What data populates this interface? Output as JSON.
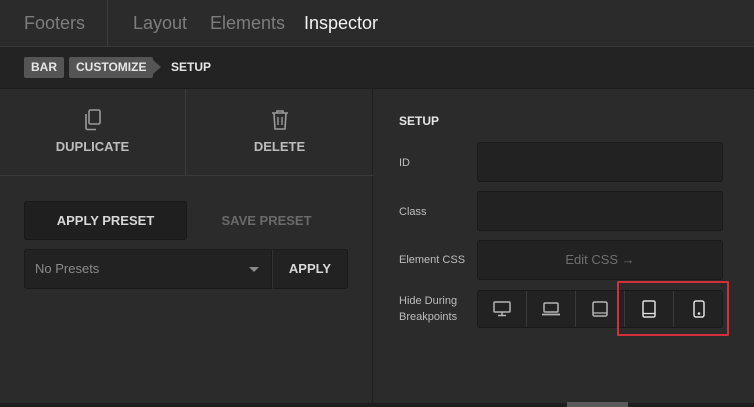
{
  "tabs": [
    {
      "label": "Footers"
    },
    {
      "label": "Layout"
    },
    {
      "label": "Elements"
    },
    {
      "label": "Inspector"
    }
  ],
  "breadcrumb": [
    "BAR",
    "CUSTOMIZE",
    "SETUP"
  ],
  "actions": {
    "duplicate_label": "DUPLICATE",
    "delete_label": "DELETE",
    "duplicate_icon": "copy-icon",
    "delete_icon": "trash-icon"
  },
  "presets": {
    "apply_preset_label": "APPLY PRESET",
    "save_preset_label": "SAVE PRESET",
    "select_value": "No Presets",
    "apply_label": "APPLY"
  },
  "setup": {
    "title": "SETUP",
    "id_label": "ID",
    "id_value": "",
    "class_label": "Class",
    "class_value": "",
    "css_label": "Element CSS",
    "css_button": "Edit CSS →",
    "hide_label_1": "Hide During",
    "hide_label_2": "Breakpoints",
    "breakpoints": [
      "desktop-icon",
      "laptop-icon",
      "tablet-landscape-icon",
      "tablet-portrait-icon",
      "phone-icon"
    ]
  },
  "colors": {
    "highlight": "#d32f3a",
    "active_tab": "#f2f2f2"
  }
}
